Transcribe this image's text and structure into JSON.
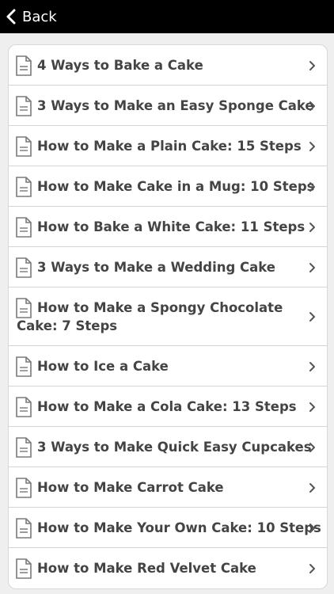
{
  "header": {
    "back_label": "Back"
  },
  "items": [
    {
      "label": "4 Ways to Bake a Cake"
    },
    {
      "label": "3 Ways to Make an Easy Sponge Cake"
    },
    {
      "label": "How to Make a Plain Cake: 15 Steps"
    },
    {
      "label": "How to Make Cake in a Mug: 10 Steps"
    },
    {
      "label": "How to Bake a White Cake: 11 Steps"
    },
    {
      "label": "3 Ways to Make a Wedding Cake"
    },
    {
      "label": "How to Make a Spongy Chocolate Cake: 7 Steps"
    },
    {
      "label": "How to Ice a Cake"
    },
    {
      "label": "How to Make a Cola Cake: 13 Steps"
    },
    {
      "label": "3 Ways to Make Quick Easy Cupcakes"
    },
    {
      "label": "How to Make Carrot Cake"
    },
    {
      "label": "How to Make Your Own Cake: 10 Steps"
    },
    {
      "label": "How to Make Red Velvet Cake"
    }
  ],
  "icons": {
    "back": "chevron-left-icon",
    "item": "document-icon",
    "disclosure": "chevron-right-icon"
  },
  "colors": {
    "header_bg": "#000000",
    "text": "#444444",
    "icon": "#7a7a7a"
  }
}
